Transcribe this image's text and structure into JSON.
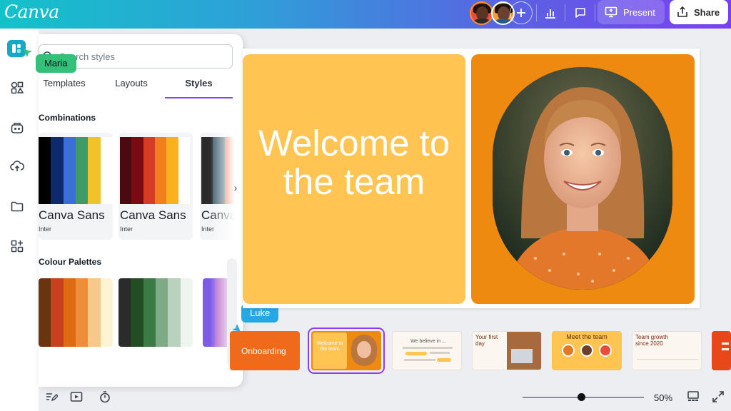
{
  "app": {
    "logo": "Canva"
  },
  "topbar": {
    "present_label": "Present",
    "share_label": "Share",
    "icons": [
      "plus-icon",
      "chart-icon",
      "comment-icon",
      "present-icon",
      "share-icon"
    ]
  },
  "panel": {
    "search_placeholder": "Search styles",
    "tabs": [
      {
        "label": "Templates"
      },
      {
        "label": "Layouts"
      },
      {
        "label": "Styles"
      }
    ],
    "combinations_title": "Combinations",
    "combinations": [
      {
        "font": "Canva Sans",
        "sub": "Inter",
        "colors": [
          "#000000",
          "#0d2a6e",
          "#3a6fd8",
          "#3f9b65",
          "#f2c22a",
          "#ffffff"
        ]
      },
      {
        "font": "Canva Sans",
        "sub": "Inter",
        "colors": [
          "#4a0a10",
          "#7a0b12",
          "#d63b23",
          "#f17f1a",
          "#f9b21e",
          "#ffffff"
        ]
      },
      {
        "font": "Canva Sans",
        "sub": "Inter",
        "colors": [
          "#2b2b2b",
          "#3a5a6b",
          "#e7562a",
          "#f9a0a0",
          "#ffffff",
          "#ffffff"
        ]
      }
    ],
    "palettes_title": "Colour Palettes",
    "palettes": [
      {
        "colors": [
          "#6b3410",
          "#c8401e",
          "#de6a12",
          "#ef8e3a",
          "#f6c88a",
          "#fff3d6"
        ]
      },
      {
        "colors": [
          "#2b2b2b",
          "#224d22",
          "#3c7a45",
          "#7faa86",
          "#b8d2bd",
          "#eef4ee"
        ]
      },
      {
        "colors": [
          "#7d5ae8",
          "#b05ac5",
          "#e35ab2",
          "#f7a1c6",
          "#ffffff",
          "#ffffff"
        ]
      }
    ]
  },
  "collaborators": {
    "maria": "Maria",
    "luke": "Luke"
  },
  "slide": {
    "title": "Welcome to the team"
  },
  "filmstrip": [
    {
      "title": "Onboarding",
      "bg": "#ef6a1a"
    },
    {
      "title": "Welcome to the team",
      "bg": "#ffc452",
      "selected": true
    },
    {
      "title": "We believe in ...",
      "bg": "#fbf6ef"
    },
    {
      "title": "Your first day",
      "bg": "#fbf6ef"
    },
    {
      "title": "Meet the team",
      "bg": "#ffc452"
    },
    {
      "title": "Team growth since 2020",
      "bg": "#fbf6ef"
    },
    {
      "title": "",
      "bg": "#e8471a"
    }
  ],
  "bottom": {
    "zoom": "50%",
    "zoom_fraction": 0.5
  }
}
